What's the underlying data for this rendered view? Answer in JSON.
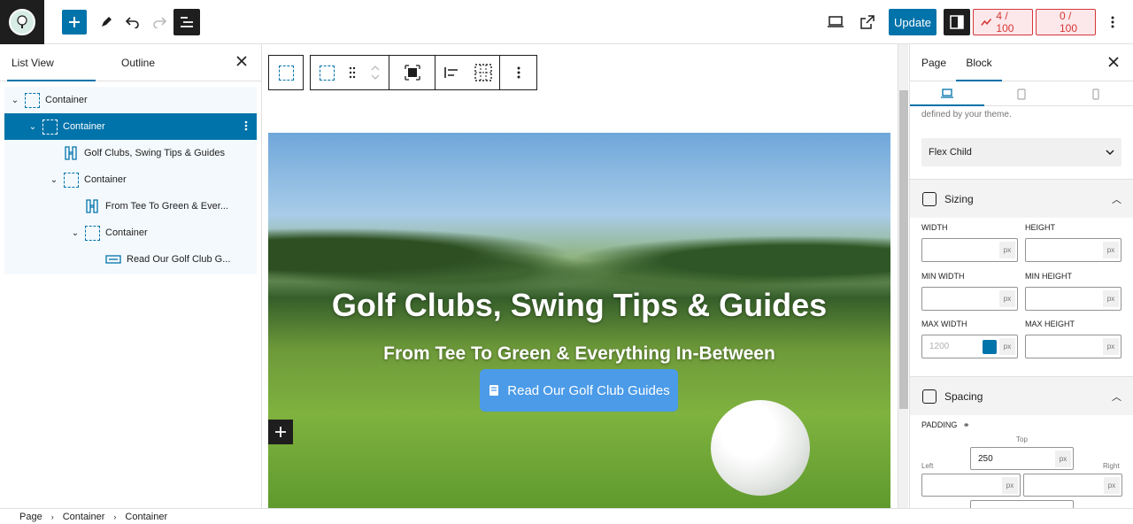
{
  "topbar": {
    "update_label": "Update",
    "counter1_label": "4 / 100",
    "counter2_label": "0 / 100"
  },
  "left_panel": {
    "tabs": [
      "List View",
      "Outline"
    ],
    "tree": [
      {
        "label": "Container",
        "type": "container",
        "depth": 0
      },
      {
        "label": "Container",
        "type": "container",
        "depth": 1,
        "selected": true
      },
      {
        "label": "Golf Clubs, Swing Tips & Guides",
        "type": "heading",
        "depth": 2
      },
      {
        "label": "Container",
        "type": "container",
        "depth": 2
      },
      {
        "label": "From Tee To Green & Ever...",
        "type": "heading",
        "depth": 3
      },
      {
        "label": "Container",
        "type": "container",
        "depth": 3
      },
      {
        "label": "Read Our Golf Club G...",
        "type": "button",
        "depth": 4
      }
    ]
  },
  "hero": {
    "title": "Golf Clubs, Swing Tips & Guides",
    "subtitle": "From Tee To Green & Everything In-Between",
    "button_label": "Read Our Golf Club Guides"
  },
  "right_panel": {
    "tabs": [
      "Page",
      "Block"
    ],
    "hint": "defined by your theme.",
    "flex_select": "Flex Child",
    "sizing_title": "Sizing",
    "spacing_title": "Spacing",
    "width_label": "WIDTH",
    "height_label": "HEIGHT",
    "min_width_label": "MIN WIDTH",
    "min_height_label": "MIN HEIGHT",
    "max_width_label": "MAX WIDTH",
    "max_height_label": "MAX HEIGHT",
    "max_width_placeholder": "1200",
    "unit": "px",
    "padding_label": "PADDING",
    "top_label": "Top",
    "left_label": "Left",
    "right_label": "Right",
    "padding_top_value": "250"
  },
  "breadcrumb": [
    "Page",
    "Container",
    "Container"
  ]
}
